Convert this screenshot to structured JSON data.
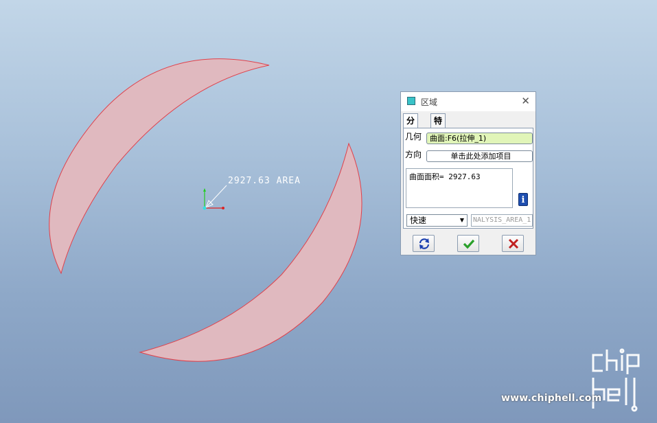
{
  "graphics": {
    "area_annotation": "2927.63 AREA",
    "surface_fill": "#e0b9bf",
    "surface_edge": "#e0404a",
    "background_top": "#c2d6e8",
    "background_bottom": "#7f98bb"
  },
  "dialog": {
    "title": "区域",
    "close_icon": "close-icon",
    "tabs": [
      {
        "label": "分析",
        "active": true
      },
      {
        "label": "特征",
        "active": false
      }
    ],
    "geometry_label": "几何",
    "geometry_value": "曲面:F6(拉伸_1)",
    "direction_label": "方向",
    "direction_value": "单击此处添加项目",
    "result_text": "曲面面积= 2927.63",
    "info_icon": "info-icon",
    "mode_select": "快速",
    "feature_name": "NALYSIS_AREA_1",
    "buttons": {
      "repeat": "repeat-icon",
      "ok": "checkmark-icon",
      "cancel": "cross-icon"
    },
    "accent_ok": "#2aa02a",
    "accent_cancel": "#c02020"
  },
  "watermark": {
    "site": "www.chiphell.com",
    "logo_text": "chip hell"
  }
}
